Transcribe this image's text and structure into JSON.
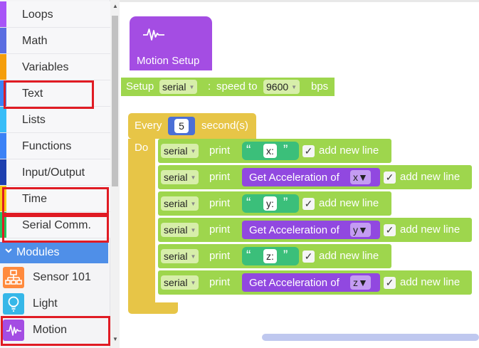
{
  "sidebar": {
    "categories": [
      {
        "label": "Loops",
        "color": "#a855f7"
      },
      {
        "label": "Math",
        "color": "#5b6ee1"
      },
      {
        "label": "Variables",
        "color": "#f59e0b"
      },
      {
        "label": "Text",
        "color": "#3b82f6"
      },
      {
        "label": "Lists",
        "color": "#38bdf8"
      },
      {
        "label": "Functions",
        "color": "#3b82f6"
      },
      {
        "label": "Input/Output",
        "color": "#1e40af"
      },
      {
        "label": "Time",
        "color": "#facc15"
      },
      {
        "label": "Serial Comm.",
        "color": "#22c55e"
      }
    ],
    "modules_header": "Modules",
    "modules": [
      {
        "label": "Sensor 101",
        "icon": "network-icon",
        "color": "#ff8a3d"
      },
      {
        "label": "Light",
        "icon": "lightbulb-icon",
        "color": "#36b7e8"
      },
      {
        "label": "Motion",
        "icon": "waveform-icon",
        "color": "#a44de3"
      }
    ],
    "highlight_color": "#e01b24"
  },
  "workspace": {
    "hat_block": {
      "label": "Motion Setup",
      "icon": "waveform-icon",
      "color": "#a44de3"
    },
    "setup_block": {
      "label": "Setup",
      "port": "serial",
      "colon": ":",
      "speed_label": "speed to",
      "speed_value": "9600",
      "unit": "bps",
      "color": "#9ed64d"
    },
    "every_block": {
      "label": "Every",
      "interval": "5",
      "unit": "second(s)",
      "do_label": "Do",
      "color": "#e7c547"
    },
    "rows": [
      {
        "port": "serial",
        "print": "print",
        "type": "string",
        "quote_open": "“",
        "value": "x:",
        "quote_close": "”",
        "new_line": "add new line"
      },
      {
        "port": "serial",
        "print": "print",
        "type": "accel",
        "func": "Get Acceleration of",
        "value": "x",
        "new_line": "add new line"
      },
      {
        "port": "serial",
        "print": "print",
        "type": "string",
        "quote_open": "“",
        "value": "y:",
        "quote_close": "”",
        "new_line": "add new line"
      },
      {
        "port": "serial",
        "print": "print",
        "type": "accel",
        "func": "Get Acceleration of",
        "value": "y",
        "new_line": "add new line"
      },
      {
        "port": "serial",
        "print": "print",
        "type": "string",
        "quote_open": "“",
        "value": "z:",
        "quote_close": "”",
        "new_line": "add new line"
      },
      {
        "port": "serial",
        "print": "print",
        "type": "accel",
        "func": "Get Acceleration of",
        "value": "z",
        "new_line": "add new line"
      }
    ],
    "checkmark": "✓"
  }
}
